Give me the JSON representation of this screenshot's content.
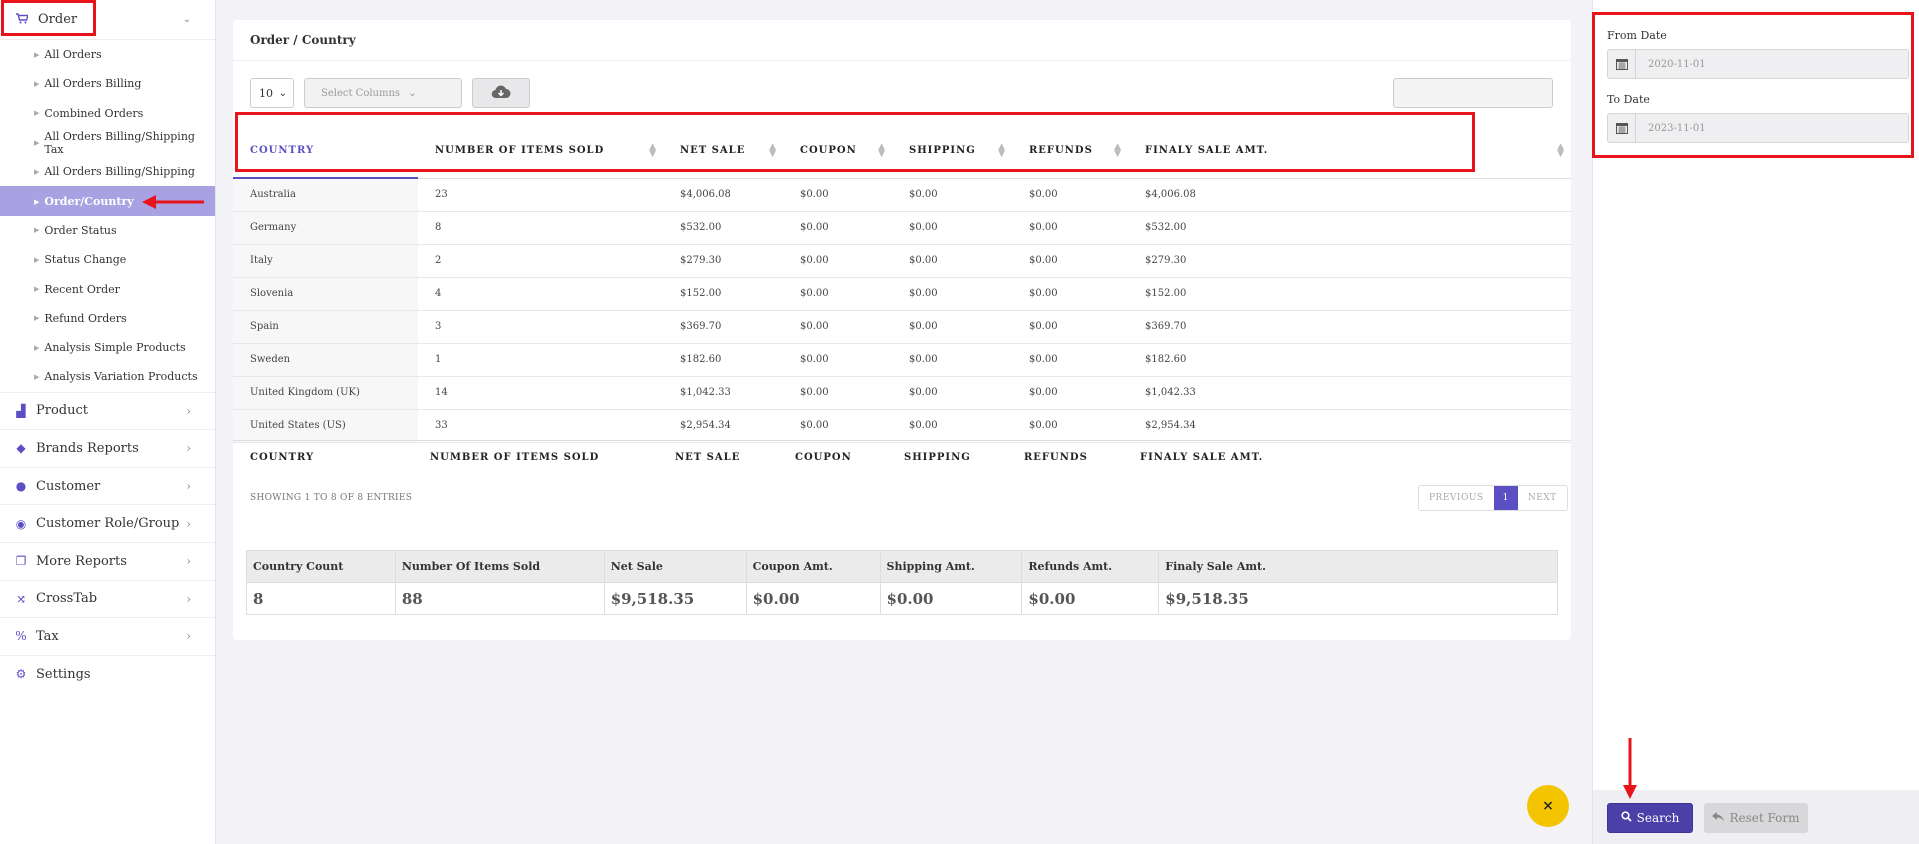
{
  "sidebar": {
    "header": {
      "label": "Order",
      "icon": "shopping-cart-icon"
    },
    "sub_items": [
      "All Orders",
      "All Orders Billing",
      "Combined Orders",
      "All Orders Billing/Shipping Tax",
      "All Orders Billing/Shipping",
      "Order/Country",
      "Order Status",
      "Status Change",
      "Recent Order",
      "Refund Orders",
      "Analysis Simple Products",
      "Analysis Variation Products"
    ],
    "active_item": "Order/Country",
    "main_items": [
      {
        "label": "Product",
        "icon": "shopping-bag-icon"
      },
      {
        "label": "Brands Reports",
        "icon": "tag-icon"
      },
      {
        "label": "Customer",
        "icon": "user-icon"
      },
      {
        "label": "Customer Role/Group",
        "icon": "user-circle-icon"
      },
      {
        "label": "More Reports",
        "icon": "copy-icon"
      },
      {
        "label": "CrossTab",
        "icon": "shuffle-icon"
      },
      {
        "label": "Tax",
        "icon": "percent-icon"
      },
      {
        "label": "Settings",
        "icon": "gears-icon"
      }
    ]
  },
  "card": {
    "title": "Order / Country",
    "page_length": "10",
    "select_columns_placeholder": "Select Columns",
    "columns": [
      "COUNTRY",
      "NUMBER OF ITEMS SOLD",
      "NET SALE",
      "COUPON",
      "SHIPPING",
      "REFUNDS",
      "FINALY SALE AMT."
    ],
    "rows": [
      [
        "Australia",
        "23",
        "$4,006.08",
        "$0.00",
        "$0.00",
        "$0.00",
        "$4,006.08"
      ],
      [
        "Germany",
        "8",
        "$532.00",
        "$0.00",
        "$0.00",
        "$0.00",
        "$532.00"
      ],
      [
        "Italy",
        "2",
        "$279.30",
        "$0.00",
        "$0.00",
        "$0.00",
        "$279.30"
      ],
      [
        "Slovenia",
        "4",
        "$152.00",
        "$0.00",
        "$0.00",
        "$0.00",
        "$152.00"
      ],
      [
        "Spain",
        "3",
        "$369.70",
        "$0.00",
        "$0.00",
        "$0.00",
        "$369.70"
      ],
      [
        "Sweden",
        "1",
        "$182.60",
        "$0.00",
        "$0.00",
        "$0.00",
        "$182.60"
      ],
      [
        "United Kingdom (UK)",
        "14",
        "$1,042.33",
        "$0.00",
        "$0.00",
        "$0.00",
        "$1,042.33"
      ],
      [
        "United States (US)",
        "33",
        "$2,954.34",
        "$0.00",
        "$0.00",
        "$0.00",
        "$2,954.34"
      ]
    ],
    "entries_text": "SHOWING 1 TO 8 OF 8 ENTRIES",
    "pager": {
      "previous": "PREVIOUS",
      "current": "1",
      "next": "NEXT"
    },
    "summary": {
      "headers": [
        "Country Count",
        "Number Of Items Sold",
        "Net Sale",
        "Coupon Amt.",
        "Shipping Amt.",
        "Refunds Amt.",
        "Finaly Sale Amt."
      ],
      "values": [
        "8",
        "88",
        "$9,518.35",
        "$0.00",
        "$0.00",
        "$0.00",
        "$9,518.35"
      ]
    }
  },
  "filters": {
    "from_label": "From Date",
    "from_value": "2020-11-01",
    "to_label": "To Date",
    "to_value": "2023-11-01",
    "search_label": "Search",
    "reset_label": "Reset Form"
  },
  "fab": {
    "label": "×"
  },
  "colors": {
    "accent": "#5b4fc4",
    "highlight": "#e8141c",
    "fab": "#f5c400"
  }
}
